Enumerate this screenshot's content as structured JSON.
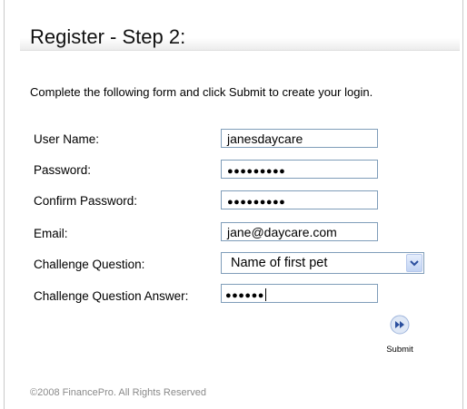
{
  "page": {
    "title": "Register - Step 2:",
    "instructions": "Complete the following form and click Submit to create your login.",
    "footer": "©2008 FinancePro. All Rights Reserved"
  },
  "form": {
    "username": {
      "label": "User Name:",
      "value": "janesdaycare"
    },
    "password": {
      "label": "Password:",
      "value": "●●●●●●●●●"
    },
    "confirm_password": {
      "label": "Confirm Password:",
      "value": "●●●●●●●●●"
    },
    "email": {
      "label": "Email:",
      "value": "jane@daycare.com"
    },
    "challenge_question": {
      "label": "Challenge Question:",
      "selected": "Name of first pet",
      "icon": "chevron-down-icon"
    },
    "challenge_answer": {
      "label": "Challenge Question Answer:",
      "value": "●●●●●●"
    }
  },
  "submit": {
    "label": "Submit",
    "icon": "fast-forward-icon"
  },
  "colors": {
    "field_border": "#7f9db9",
    "submit_circle": "#dfe8f6",
    "submit_arrow": "#2b4f9e",
    "footer_text": "#8a8a8a"
  }
}
